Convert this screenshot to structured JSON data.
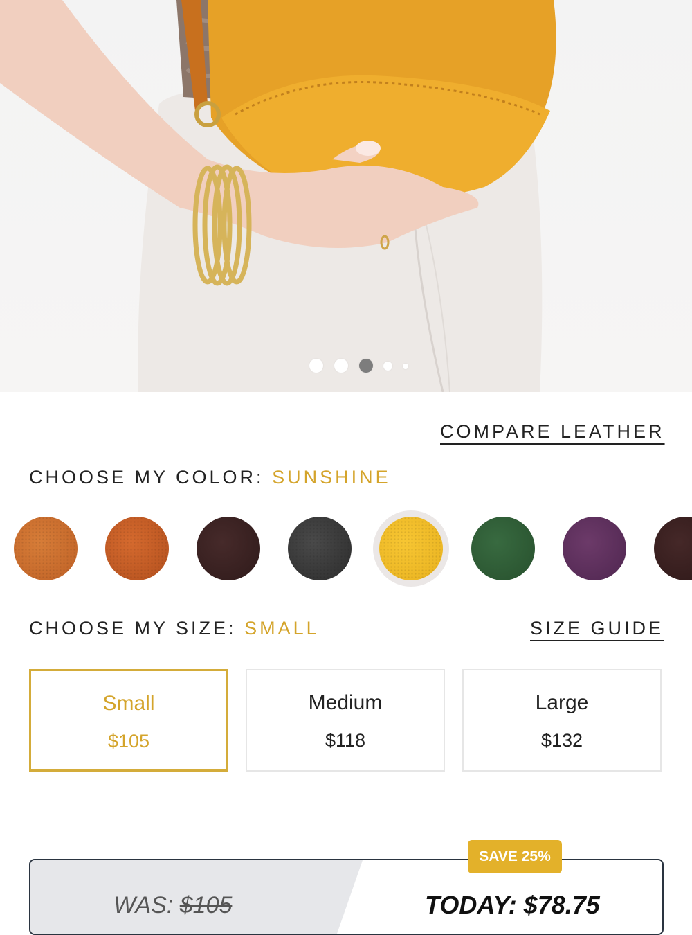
{
  "product": {
    "compare_link": "COMPARE LEATHER",
    "color": {
      "label": "CHOOSE MY COLOR:",
      "selected": "SUNSHINE",
      "swatches": [
        {
          "name": "embossed-tan",
          "hex": "#cc6e2e"
        },
        {
          "name": "cognac",
          "hex": "#c65a24"
        },
        {
          "name": "chocolate",
          "hex": "#3a2222"
        },
        {
          "name": "black",
          "hex": "#3b3b3b"
        },
        {
          "name": "sunshine",
          "hex": "#efbc25"
        },
        {
          "name": "green",
          "hex": "#2f5a36"
        },
        {
          "name": "plum",
          "hex": "#5e2f5c"
        },
        {
          "name": "espresso",
          "hex": "#3a2020"
        }
      ]
    },
    "size": {
      "label": "CHOOSE MY SIZE:",
      "selected": "SMALL",
      "guide_link": "SIZE GUIDE",
      "options": [
        {
          "name": "Small",
          "price": "$105"
        },
        {
          "name": "Medium",
          "price": "$118"
        },
        {
          "name": "Large",
          "price": "$132"
        }
      ]
    },
    "pricing": {
      "badge": "SAVE 25%",
      "was_label": "WAS:",
      "was_price": "$105",
      "today": "TODAY: $78.75"
    },
    "carousel": {
      "total": 5,
      "active": 3
    },
    "colors": {
      "accent": "#d4a42b",
      "badge": "#e3b12a",
      "border": "#2a3440"
    }
  }
}
